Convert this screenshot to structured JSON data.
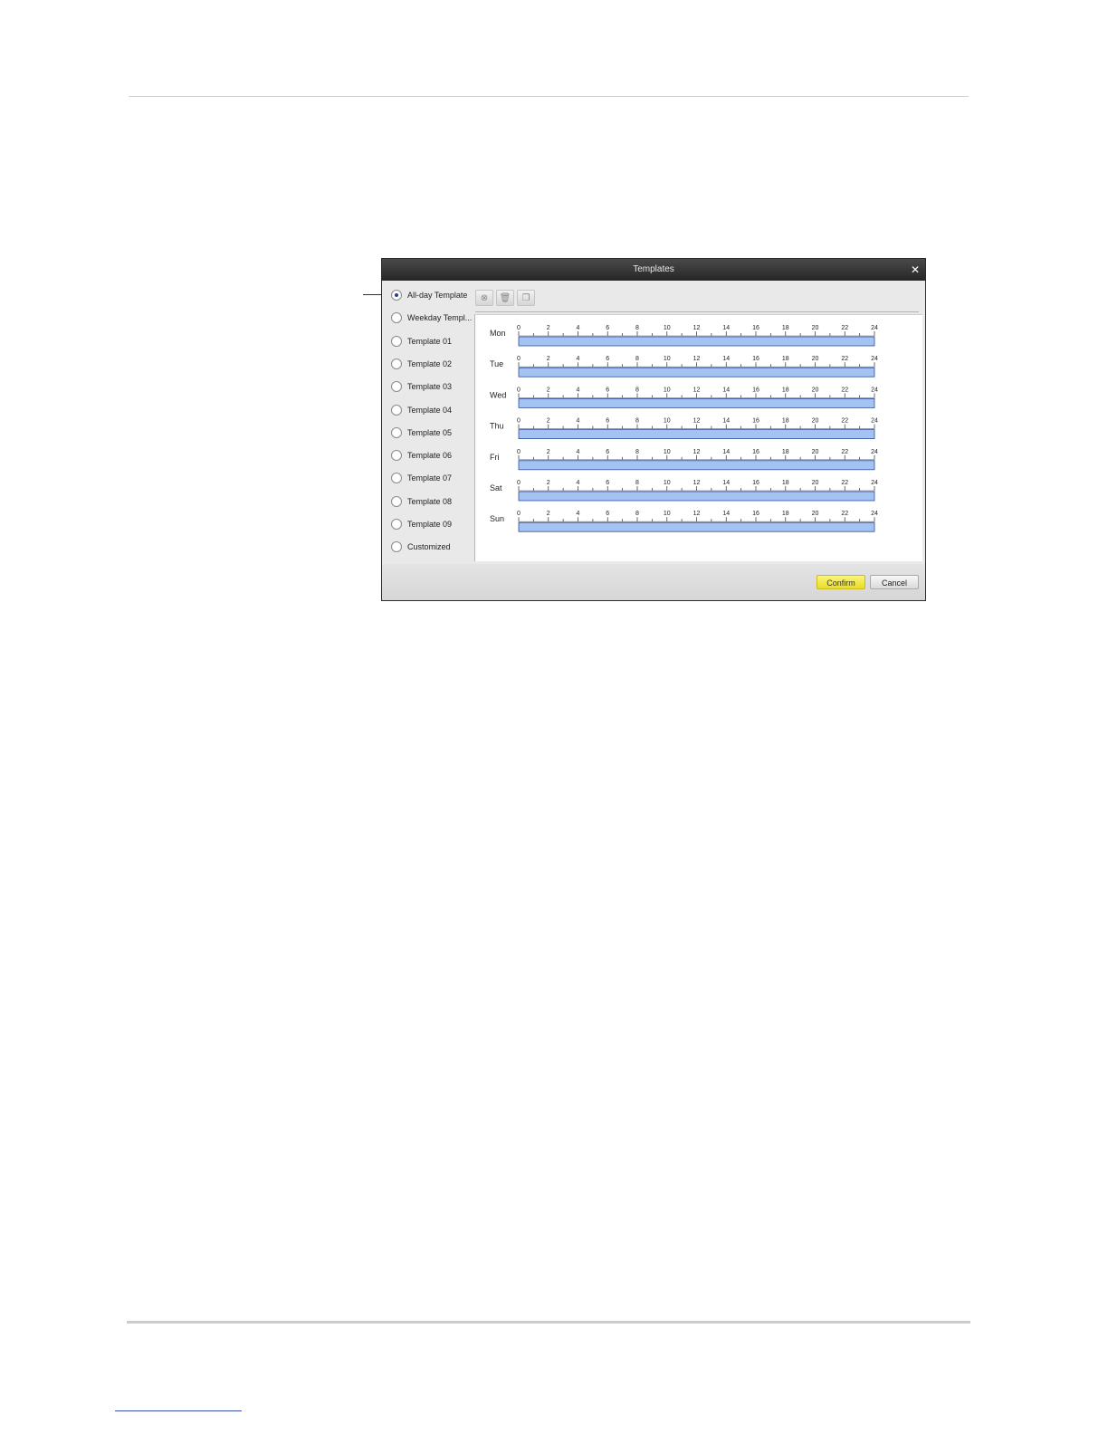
{
  "dialog": {
    "title": "Templates",
    "close_glyph": "✕"
  },
  "templates": [
    {
      "label": "All-day Template",
      "selected": true
    },
    {
      "label": "Weekday Templ...",
      "selected": false
    },
    {
      "label": "Template 01",
      "selected": false
    },
    {
      "label": "Template 02",
      "selected": false
    },
    {
      "label": "Template 03",
      "selected": false
    },
    {
      "label": "Template 04",
      "selected": false
    },
    {
      "label": "Template 05",
      "selected": false
    },
    {
      "label": "Template 06",
      "selected": false
    },
    {
      "label": "Template 07",
      "selected": false
    },
    {
      "label": "Template 08",
      "selected": false
    },
    {
      "label": "Template 09",
      "selected": false
    },
    {
      "label": "Customized",
      "selected": false
    }
  ],
  "toolbar": {
    "buttons": [
      {
        "icon": "delete-circle-icon",
        "glyph": "⊗"
      },
      {
        "icon": "trash-icon",
        "glyph": "🗑"
      },
      {
        "icon": "copy-icon",
        "glyph": "❐"
      }
    ]
  },
  "schedule": {
    "hour_labels": [
      "0",
      "2",
      "4",
      "6",
      "8",
      "10",
      "12",
      "14",
      "16",
      "18",
      "20",
      "22",
      "24"
    ],
    "days": [
      {
        "label": "Mon",
        "start": 0,
        "end": 24
      },
      {
        "label": "Tue",
        "start": 0,
        "end": 24
      },
      {
        "label": "Wed",
        "start": 0,
        "end": 24
      },
      {
        "label": "Thu",
        "start": 0,
        "end": 24
      },
      {
        "label": "Fri",
        "start": 0,
        "end": 24
      },
      {
        "label": "Sat",
        "start": 0,
        "end": 24
      },
      {
        "label": "Sun",
        "start": 0,
        "end": 24
      }
    ],
    "bar_color": "#a4c3f2",
    "bar_border": "#2f4f9c"
  },
  "footer": {
    "confirm_label": "Confirm",
    "cancel_label": "Cancel"
  }
}
